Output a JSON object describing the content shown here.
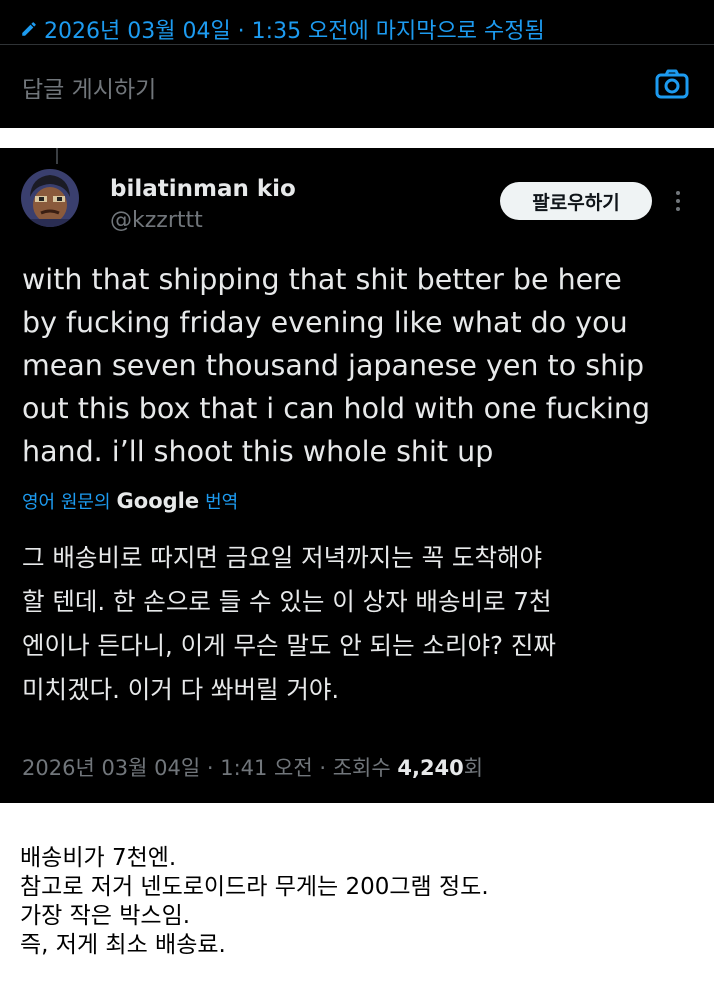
{
  "top_bar": {
    "edited_text": "2026년 03월 04일 · 1:35 오전에 마지막으로 수정됨",
    "reply_placeholder": "답글 게시하기",
    "camera_icon": "camera-icon",
    "colors": {
      "accent": "#1d9bf0",
      "muted": "#71767b"
    }
  },
  "tweet": {
    "display_name": "bilatinman kio",
    "handle": "@kzzrttt",
    "follow_label": "팔로우하기",
    "body_lines": [
      "with that shipping that shit better be here",
      "by fucking friday evening like what do you",
      "mean seven thousand japanese yen to ship",
      "out this box that i can hold with one fucking",
      "hand. i’ll shoot this whole shit up"
    ],
    "translate": {
      "prefix": "영어 원문의",
      "brand": "Google",
      "suffix": "번역"
    },
    "translation_lines": [
      "그 배송비로 따지면 금요일 저녁까지는 꼭 도착해야",
      "할 텐데. 한 손으로 들 수 있는 이 상자 배송비로 7천",
      "엔이나 든다니, 이게 무슨 말도 안 되는 소리야? 진짜",
      "미치겠다. 이거 다 쏴버릴 거야."
    ],
    "meta": {
      "timestamp": "2026년 03월 04일 · 1:41 오전 · 조회수 ",
      "views": "4,240",
      "views_suffix": "회"
    }
  },
  "caption": {
    "lines": [
      "배송비가 7천엔.",
      "참고로 저거 넨도로이드라 무게는 200그램 정도.",
      "가장 작은 박스임.",
      "즉, 저게 최소 배송료."
    ]
  }
}
